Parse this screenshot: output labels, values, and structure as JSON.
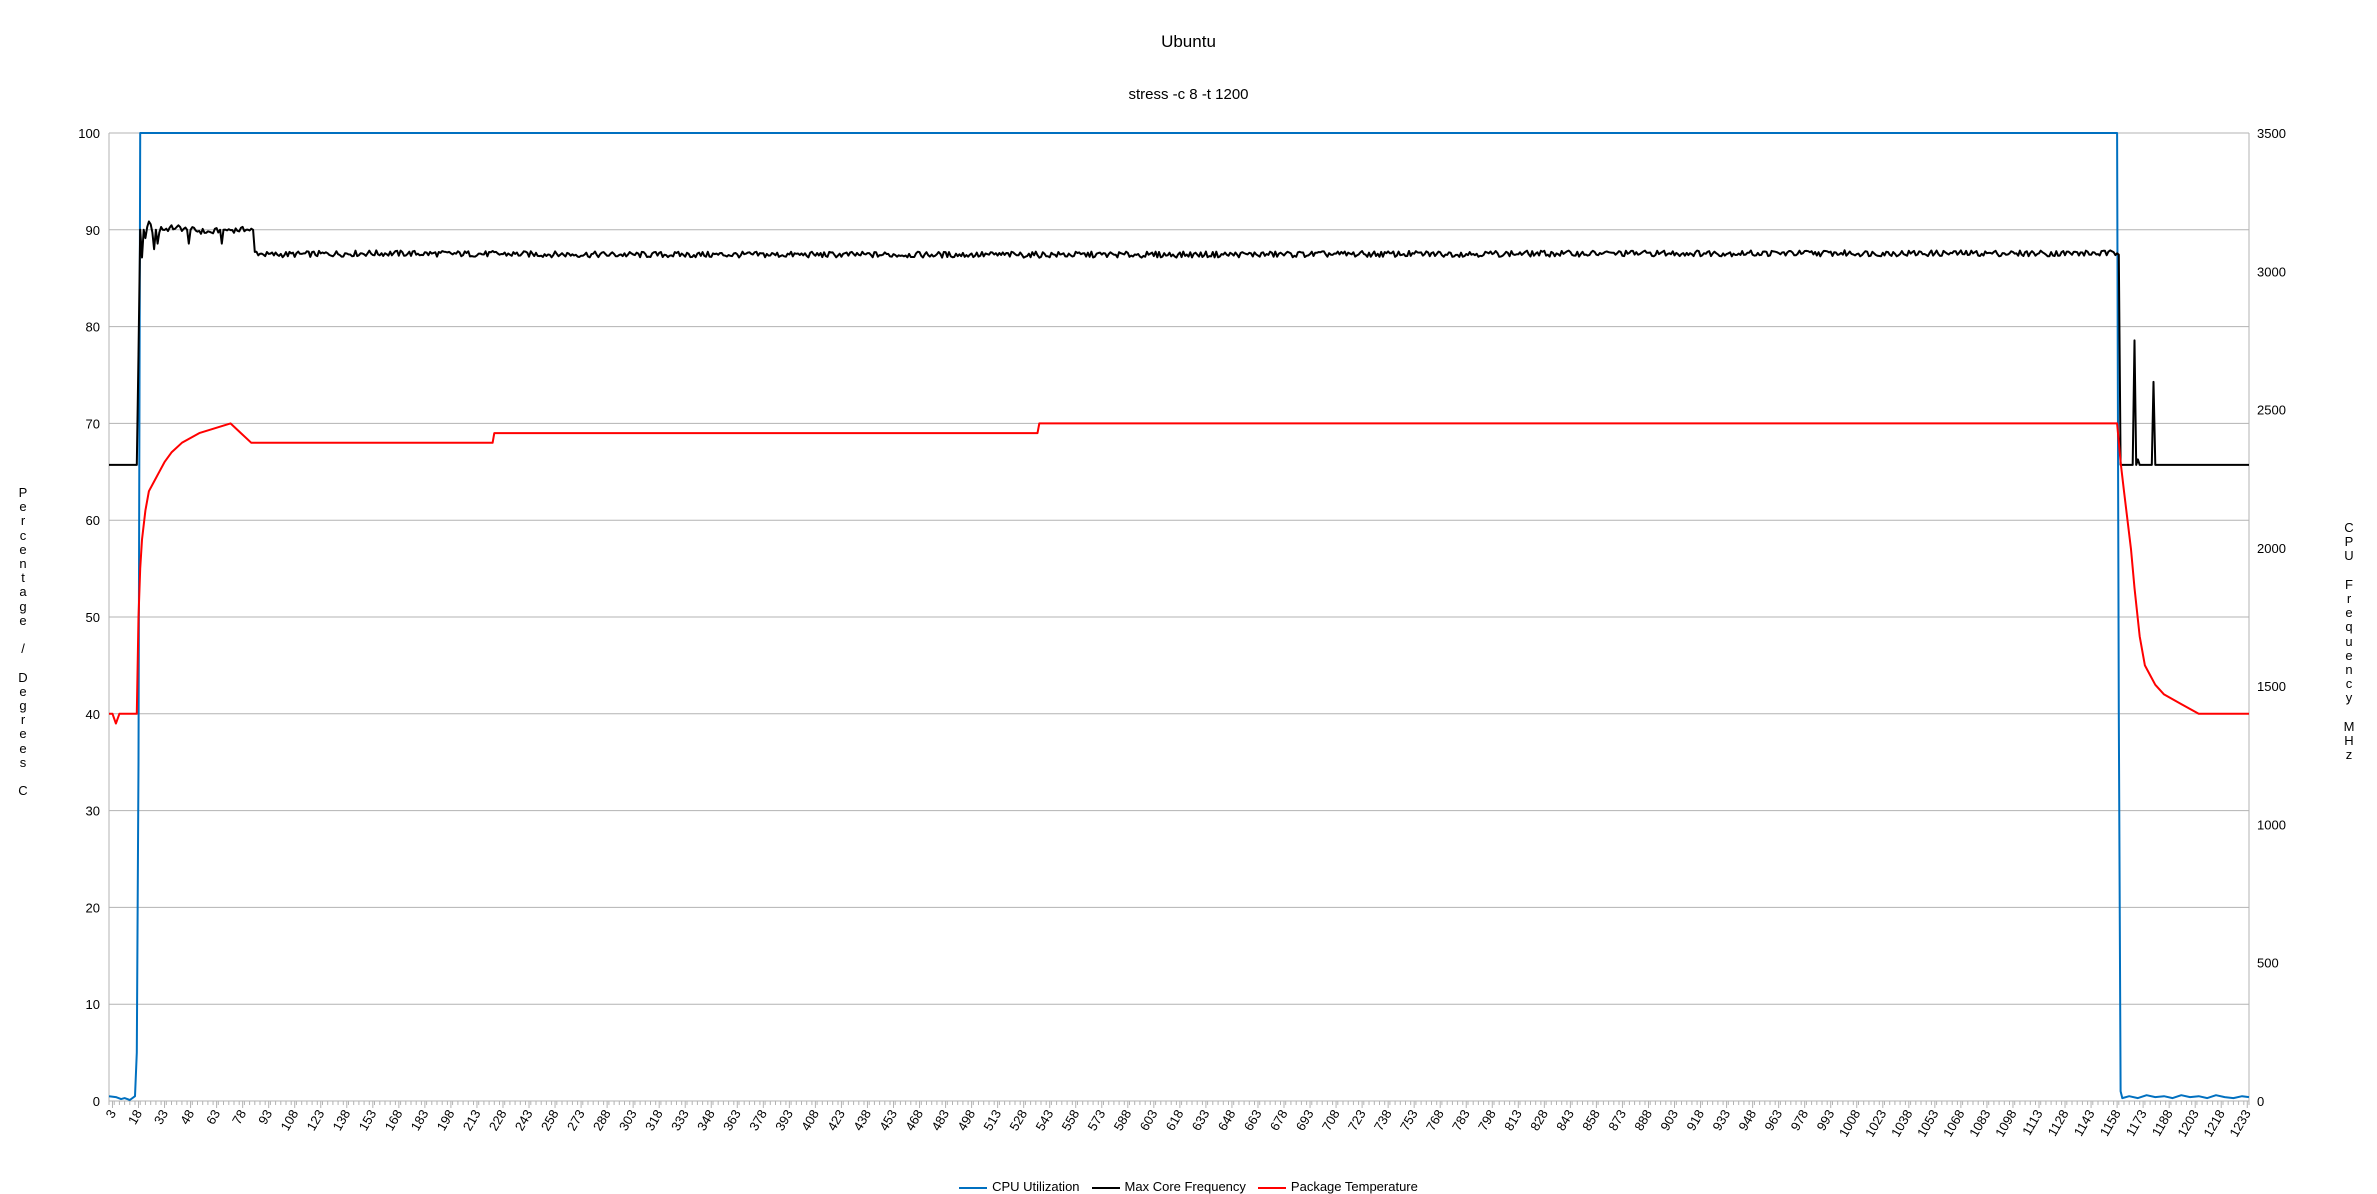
{
  "chart_data": {
    "type": "line",
    "title": "Ubuntu",
    "subtitle": "stress -c 8 -t 1200",
    "ylabel": "Percentage / Degrees C",
    "y2label": "CPU Frequency MHz",
    "xlabel": "",
    "ylim": [
      0,
      100
    ],
    "y2lim": [
      0,
      3500
    ],
    "yticks": [
      0,
      10,
      20,
      30,
      40,
      50,
      60,
      70,
      80,
      90,
      100
    ],
    "y2ticks": [
      0,
      500,
      1000,
      1500,
      2000,
      2500,
      3000,
      3500
    ],
    "xlim": [
      1,
      1234
    ],
    "xtick_start": 3,
    "xtick_step": 15,
    "xtick_count": 83,
    "grid": true,
    "legend_position": "bottom",
    "series": [
      {
        "name": "CPU Utilization",
        "axis": "left",
        "color": "#0070c0",
        "points": [
          [
            1,
            0.5
          ],
          [
            5,
            0.4
          ],
          [
            8,
            0.2
          ],
          [
            10,
            0.3
          ],
          [
            13,
            0.1
          ],
          [
            16,
            0.5
          ],
          [
            17,
            5
          ],
          [
            18,
            35
          ],
          [
            19,
            100
          ],
          [
            1158,
            100
          ],
          [
            1159,
            40
          ],
          [
            1160,
            1
          ],
          [
            1161,
            0.3
          ],
          [
            1165,
            0.5
          ],
          [
            1170,
            0.3
          ],
          [
            1175,
            0.6
          ],
          [
            1180,
            0.4
          ],
          [
            1185,
            0.5
          ],
          [
            1190,
            0.3
          ],
          [
            1195,
            0.6
          ],
          [
            1200,
            0.4
          ],
          [
            1205,
            0.5
          ],
          [
            1210,
            0.3
          ],
          [
            1215,
            0.6
          ],
          [
            1220,
            0.4
          ],
          [
            1225,
            0.3
          ],
          [
            1230,
            0.5
          ],
          [
            1234,
            0.4
          ]
        ]
      },
      {
        "name": "Max Core Frequency",
        "axis": "right",
        "color": "#000000",
        "points": [
          [
            1,
            2300
          ],
          [
            17,
            2300
          ],
          [
            18,
            2700
          ],
          [
            19,
            3150
          ],
          [
            20,
            3050
          ],
          [
            21,
            3150
          ],
          [
            22,
            3120
          ],
          [
            23,
            3160
          ],
          [
            24,
            3180
          ],
          [
            25,
            3170
          ],
          [
            26,
            3140
          ],
          [
            27,
            3080
          ],
          [
            28,
            3150
          ],
          [
            29,
            3100
          ],
          [
            30,
            3140
          ],
          [
            31,
            3160
          ],
          [
            32,
            3150
          ],
          [
            40,
            3160
          ],
          [
            46,
            3150
          ],
          [
            47,
            3100
          ],
          [
            48,
            3150
          ],
          [
            60,
            3140
          ],
          [
            65,
            3150
          ],
          [
            66,
            3100
          ],
          [
            67,
            3150
          ],
          [
            80,
            3150
          ],
          [
            84,
            3150
          ],
          [
            85,
            3070
          ],
          [
            90,
            3060
          ],
          [
            150,
            3065
          ],
          [
            300,
            3060
          ],
          [
            600,
            3060
          ],
          [
            900,
            3065
          ],
          [
            1100,
            3065
          ],
          [
            1158,
            3065
          ],
          [
            1159,
            3060
          ],
          [
            1160,
            2300
          ],
          [
            1167,
            2300
          ],
          [
            1168,
            2750
          ],
          [
            1169,
            2300
          ],
          [
            1170,
            2320
          ],
          [
            1171,
            2300
          ],
          [
            1178,
            2300
          ],
          [
            1179,
            2600
          ],
          [
            1180,
            2300
          ],
          [
            1234,
            2300
          ]
        ]
      },
      {
        "name": "Package Temperature",
        "axis": "left",
        "color": "#ff0000",
        "points": [
          [
            1,
            40
          ],
          [
            3,
            40
          ],
          [
            5,
            39
          ],
          [
            7,
            40
          ],
          [
            17,
            40
          ],
          [
            18,
            50
          ],
          [
            19,
            55
          ],
          [
            20,
            58
          ],
          [
            22,
            61
          ],
          [
            24,
            63
          ],
          [
            27,
            64
          ],
          [
            30,
            65
          ],
          [
            33,
            66
          ],
          [
            37,
            67
          ],
          [
            43,
            68
          ],
          [
            53,
            69
          ],
          [
            71,
            70
          ],
          [
            77,
            69
          ],
          [
            83,
            68
          ],
          [
            222,
            68
          ],
          [
            223,
            69
          ],
          [
            536,
            69
          ],
          [
            537,
            70
          ],
          [
            1158,
            70
          ],
          [
            1160,
            66
          ],
          [
            1162,
            63
          ],
          [
            1164,
            60
          ],
          [
            1166,
            57
          ],
          [
            1168,
            53
          ],
          [
            1171,
            48
          ],
          [
            1174,
            45
          ],
          [
            1177,
            44
          ],
          [
            1180,
            43
          ],
          [
            1185,
            42
          ],
          [
            1195,
            41
          ],
          [
            1205,
            40
          ],
          [
            1234,
            40
          ]
        ]
      }
    ]
  }
}
